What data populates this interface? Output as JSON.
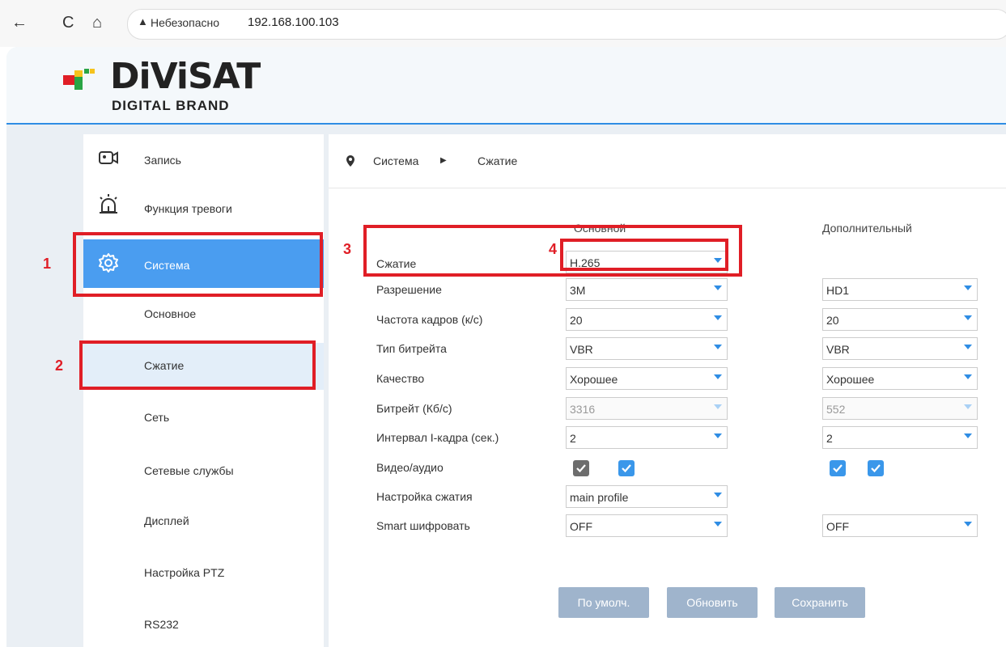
{
  "browser": {
    "back_icon": "←",
    "reload_icon": "C",
    "home_icon": "⌂",
    "warning_icon": "▲",
    "insecure_label": "Небезопасно",
    "url": "192.168.100.103"
  },
  "logo": {
    "brand": "DiViSAT",
    "tagline": "DIGITAL BRAND",
    "colors": [
      "#e01e26",
      "#f6c31c",
      "#29a545"
    ]
  },
  "sidebar": {
    "items": [
      {
        "label": "Запись",
        "icon": "camera-icon"
      },
      {
        "label": "Функция тревоги",
        "icon": "alarm-icon"
      },
      {
        "label": "Система",
        "icon": "gear-icon"
      },
      {
        "label": "Основное"
      },
      {
        "label": "Сжатие"
      },
      {
        "label": "Сеть"
      },
      {
        "label": "Сетевые службы"
      },
      {
        "label": "Дисплей"
      },
      {
        "label": "Настройка PTZ"
      },
      {
        "label": "RS232"
      }
    ]
  },
  "breadcrumb": {
    "icon": "location-pin-icon",
    "level1": "Система",
    "separator": "▶",
    "level2": "Сжатие"
  },
  "columns": {
    "main": "Основной",
    "extra": "Дополнительный"
  },
  "rows": [
    {
      "label": "Сжатие",
      "main": "H.265",
      "extra": null
    },
    {
      "label": "Разрешение",
      "main": "3M",
      "extra": "HD1"
    },
    {
      "label": "Частота кадров (к/с)",
      "main": "20",
      "extra": "20"
    },
    {
      "label": "Тип битрейта",
      "main": "VBR",
      "extra": "VBR"
    },
    {
      "label": "Качество",
      "main": "Хорошее",
      "extra": "Хорошее"
    },
    {
      "label": "Битрейт (Кб/с)",
      "main": "3316",
      "extra": "552"
    },
    {
      "label": "Интервал I-кадра (сек.)",
      "main": "2",
      "extra": "2"
    },
    {
      "label": "Видео/аудио",
      "main": "checkboxes",
      "extra": "checkboxes"
    },
    {
      "label": "Настройка сжатия",
      "main": "main profile",
      "extra": null
    },
    {
      "label": "Smart шифровать",
      "main": "OFF",
      "extra": "OFF"
    }
  ],
  "video_audio": {
    "main_video": true,
    "main_audio": true,
    "extra_video": true,
    "extra_audio": true
  },
  "buttons": {
    "default": "По умолч.",
    "refresh": "Обновить",
    "save": "Сохранить"
  },
  "annotations": [
    "1",
    "2",
    "3",
    "4"
  ],
  "colors": {
    "accent": "#4a9df0",
    "annotation": "#e01e26",
    "button": "#9fb4cc"
  }
}
